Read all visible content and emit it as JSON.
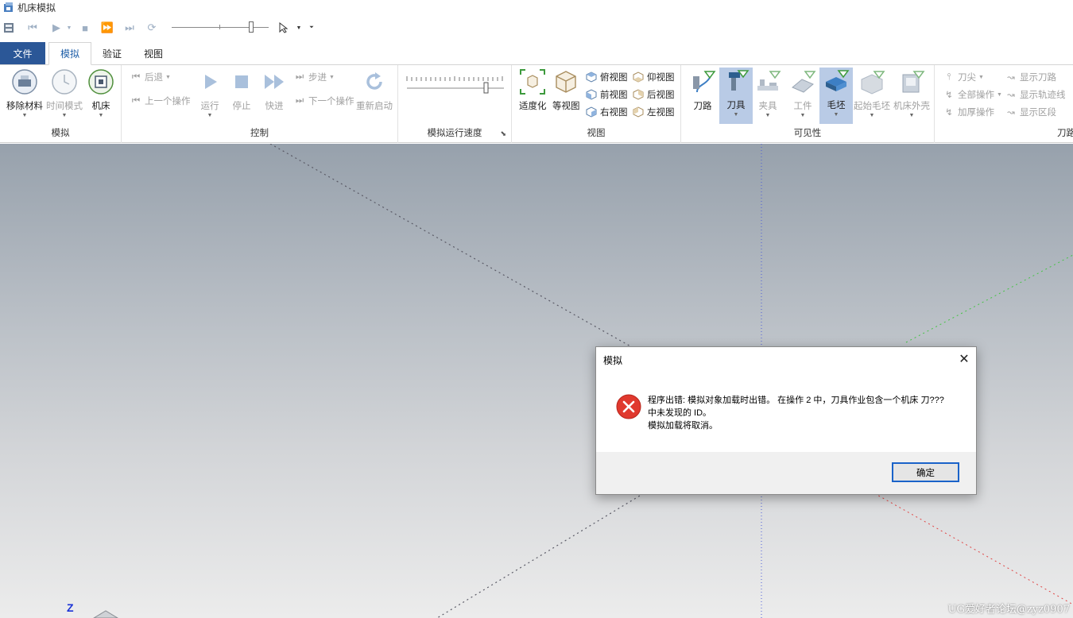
{
  "window": {
    "title": "机床模拟"
  },
  "tabs": [
    {
      "label": "文件"
    },
    {
      "label": "模拟"
    },
    {
      "label": "验证"
    },
    {
      "label": "视图"
    }
  ],
  "groups": {
    "simulate": {
      "label": "模拟",
      "buttons": [
        {
          "label": "移除材料"
        },
        {
          "label": "时间模式"
        },
        {
          "label": "机床"
        }
      ]
    },
    "control": {
      "label": "控制",
      "back": "后退",
      "prev_op": "上一个操作",
      "run": "运行",
      "stop": "停止",
      "fast": "快进",
      "step": "步进",
      "next_op": "下一个操作",
      "restart": "重新启动"
    },
    "speed": {
      "label": "模拟运行速度"
    },
    "view": {
      "label": "视图",
      "fit": "适度化",
      "iso": "等视图",
      "top": "俯视图",
      "bottom": "仰视图",
      "front": "前视图",
      "back": "后视图",
      "right": "右视图",
      "left": "左视图"
    },
    "visibility": {
      "label": "可见性",
      "toolpath": "刀路",
      "tool": "刀具",
      "fixture": "夹具",
      "workpiece": "工件",
      "stock": "毛坯",
      "initial_stock": "起始毛坯",
      "machine_housing": "机床外壳"
    },
    "toolpath": {
      "label": "刀路",
      "tool_tip": "刀尖",
      "all_ops": "全部操作",
      "thicken": "加厚操作",
      "show_toolpath": "显示刀路",
      "show_trace": "显示轨迹线",
      "show_segment": "显示区段"
    }
  },
  "viewport": {
    "z_axis_label": "Z",
    "watermark": "UG爱好者论坛@zyz0907"
  },
  "dialog": {
    "title": "模拟",
    "close_symbol": "✕",
    "message_line1": "程序出错: 模拟对象加载时出错。 在操作 2 中，刀具作业包含一个机床 刀???",
    "message_line2": "中未发现的 ID。",
    "message_line3": "模拟加载将取消。",
    "ok_label": "确定"
  }
}
